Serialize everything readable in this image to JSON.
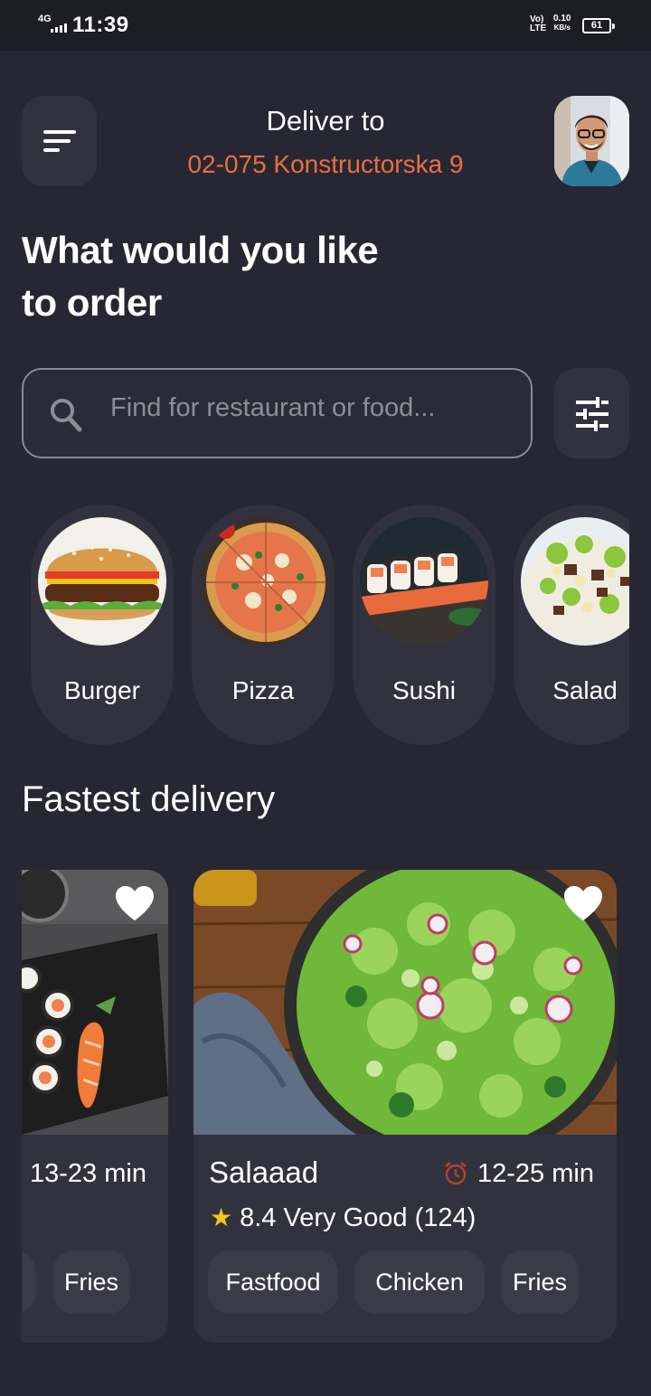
{
  "status_bar": {
    "network": "4G",
    "time": "11:39",
    "volte": "Vo¹\nLTE",
    "speed_value": "0.10",
    "speed_unit": "KB/s",
    "battery": "61"
  },
  "header": {
    "deliver_label": "Deliver to",
    "address": "02-075 Konstructorska 9",
    "menu_icon": "menu-icon",
    "avatar_icon": "user-avatar"
  },
  "headline": "What would you like to order",
  "search": {
    "placeholder": "Find for restaurant or food...",
    "search_icon": "search-icon",
    "filter_icon": "filter-sliders-icon"
  },
  "categories": [
    {
      "label": "Burger"
    },
    {
      "label": "Pizza"
    },
    {
      "label": "Sushi"
    },
    {
      "label": "Salad"
    }
  ],
  "fastest_delivery": {
    "title": "Fastest delivery",
    "cards": [
      {
        "name": "",
        "time": "13-23 min",
        "tags": [
          "",
          "Fries"
        ]
      },
      {
        "name": "Salaaad",
        "time": "12-25 min",
        "rating": "8.4 Very Good (124)",
        "tags": [
          "Fastfood",
          "Chicken",
          "Fries"
        ]
      }
    ]
  },
  "colors": {
    "background": "#272733",
    "surface": "#32323f",
    "accent": "#e8703f",
    "star": "#f5c518"
  }
}
